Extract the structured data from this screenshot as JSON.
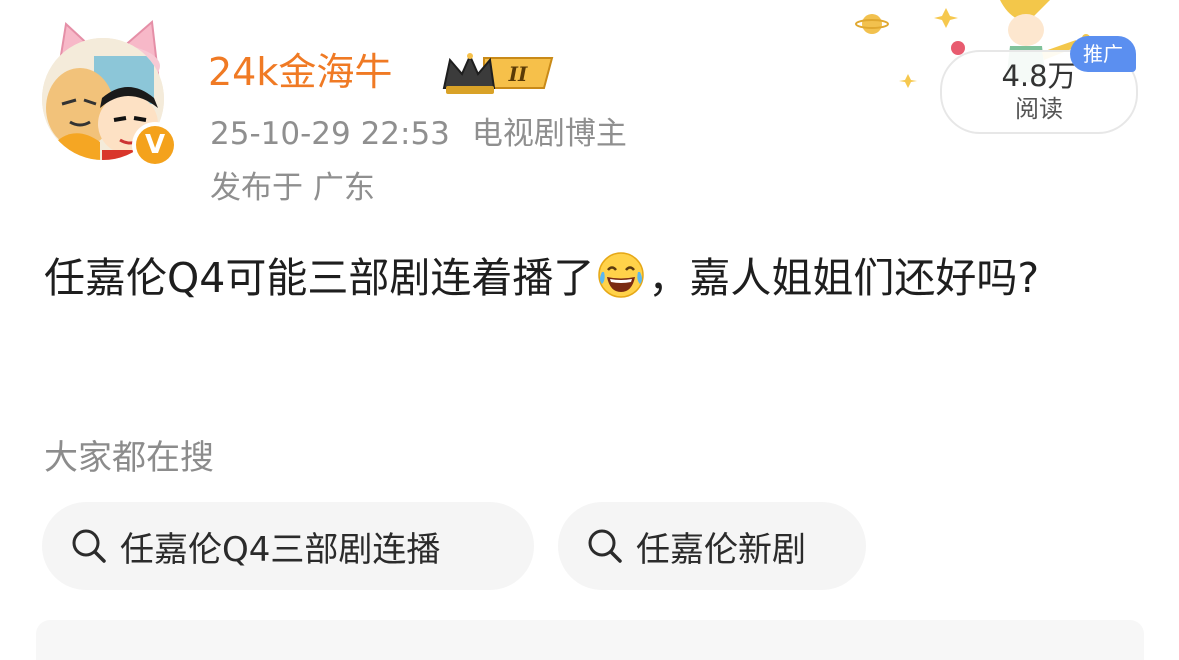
{
  "author": {
    "name": "24k金海牛",
    "badge_level": "II"
  },
  "post_meta": {
    "timestamp": "25-10-29 22:53",
    "role": "电视剧博主",
    "location": "发布于 广东"
  },
  "stats": {
    "read_count": "4.8万",
    "read_label": "阅读",
    "promo_label": "推广"
  },
  "post": {
    "text_part1": "任嘉伦Q4可能三部剧连着播了",
    "emoji": "laughing-tears-emoji",
    "text_part2": "，嘉人姐姐们还好吗?"
  },
  "search": {
    "title": "大家都在搜",
    "chips": [
      {
        "label": "任嘉伦Q4三部剧连播"
      },
      {
        "label": "任嘉伦新剧"
      }
    ]
  },
  "colors": {
    "username": "#f07a24",
    "meta": "#8f8f8f",
    "promo": "#5b8ff0",
    "verified": "#f4a21c",
    "chip_bg": "#f5f5f5"
  }
}
